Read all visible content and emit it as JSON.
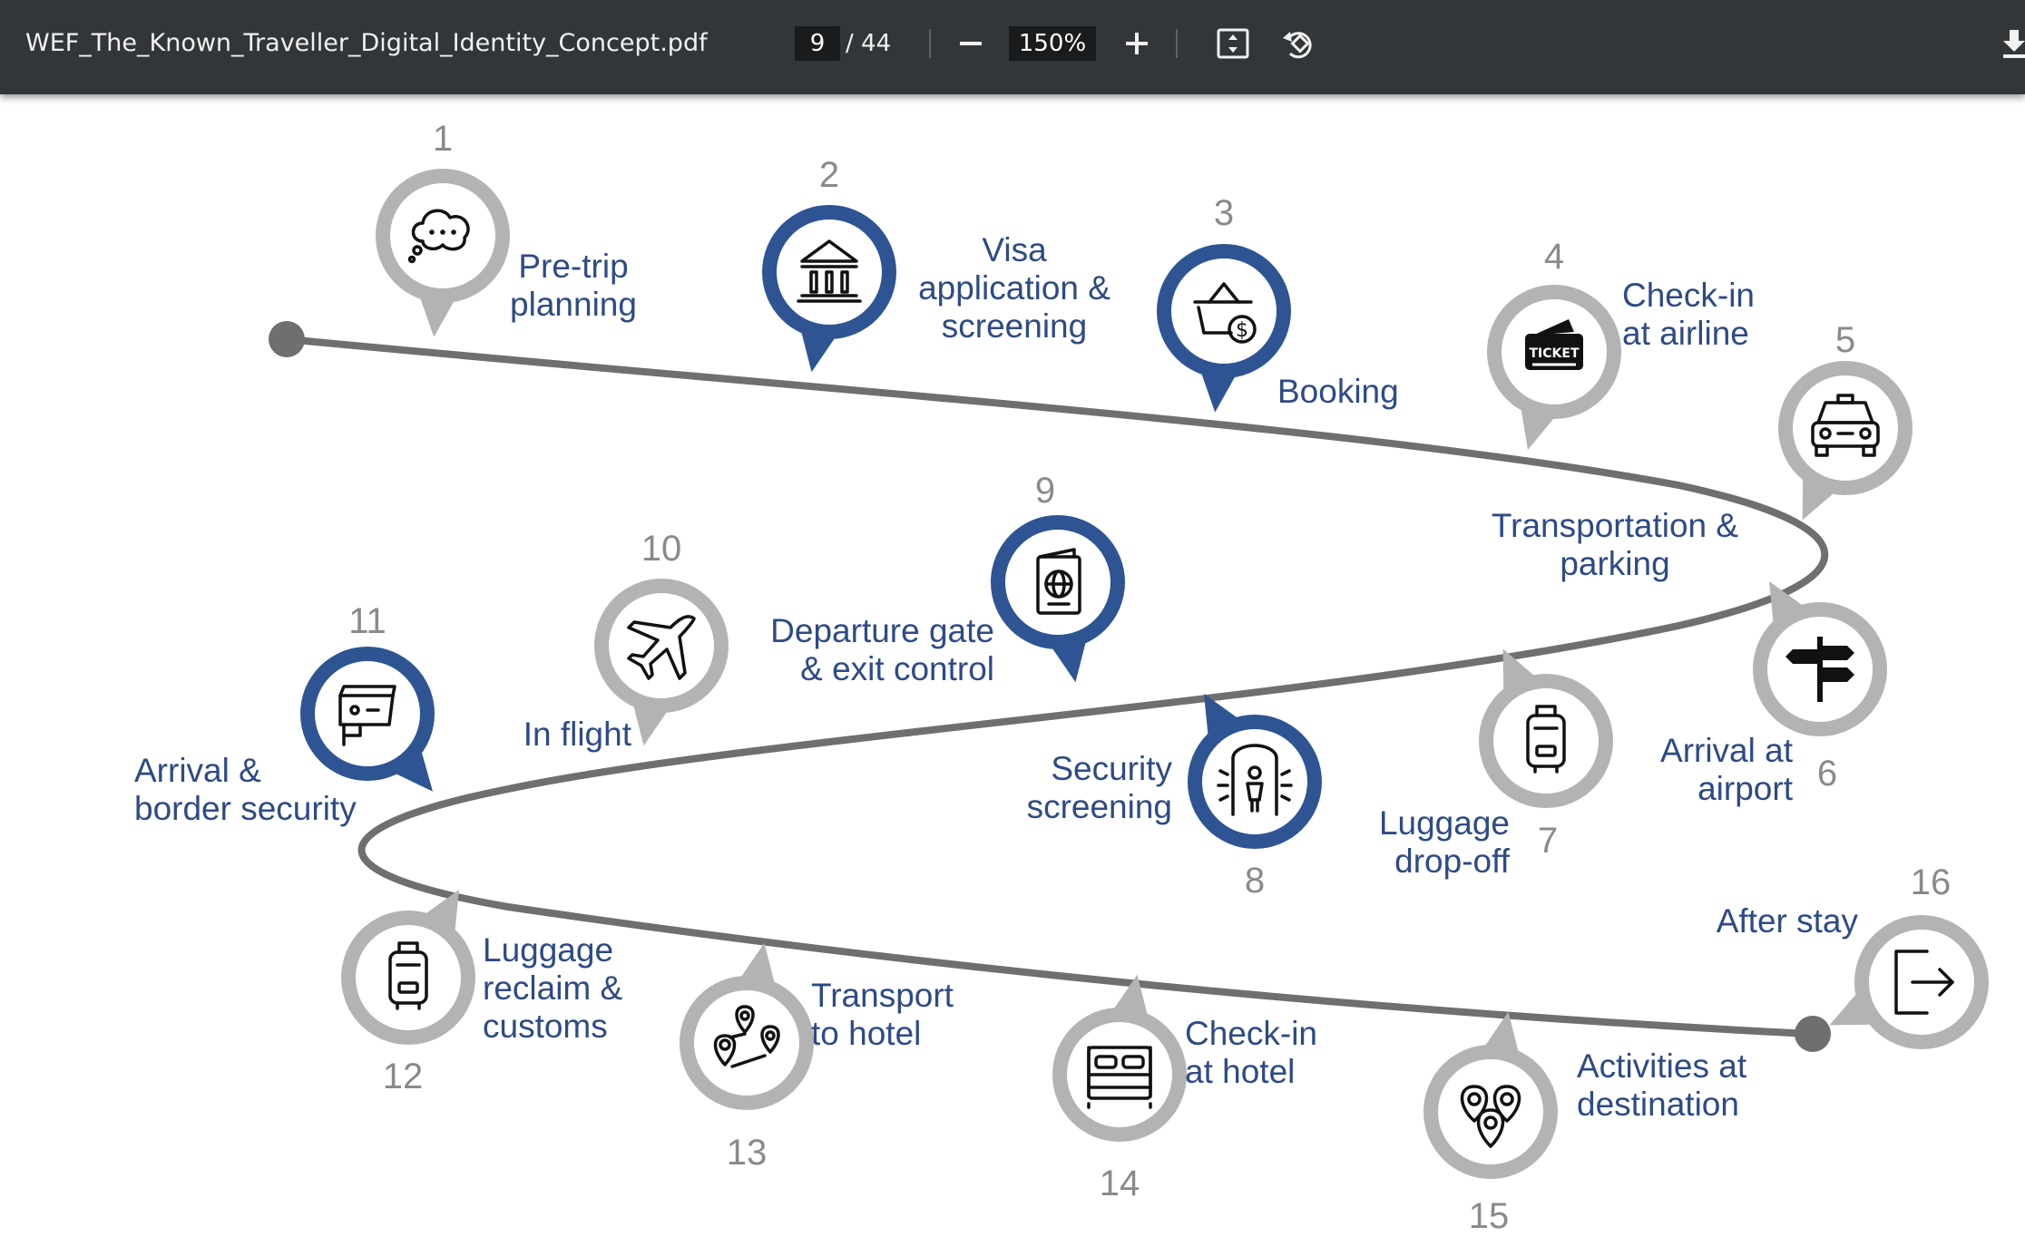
{
  "toolbar": {
    "title": "WEF_The_Known_Traveller_Digital_Identity_Concept.pdf",
    "page_current": "9",
    "page_total": "/ 44",
    "zoom": "150%",
    "icons": [
      "minus-icon",
      "plus-icon",
      "fit-page-icon",
      "rotate-icon",
      "download-icon"
    ]
  },
  "colors": {
    "toolbar_bg": "#323639",
    "blue": "#2e5493",
    "gray": "#b3b3b3",
    "path": "#6f6f6f",
    "label_text": "#2e4a86",
    "number_text": "#8a8a8a"
  },
  "steps": [
    {
      "number": "1",
      "label": [
        "Pre-trip",
        "planning"
      ],
      "style": "gray",
      "icon": "thought-bubble-icon"
    },
    {
      "number": "2",
      "label": [
        "Visa",
        "application &",
        "screening"
      ],
      "style": "blue",
      "icon": "government-building-icon"
    },
    {
      "number": "3",
      "label": [
        "Booking"
      ],
      "style": "blue",
      "icon": "shopping-basket-dollar-icon"
    },
    {
      "number": "4",
      "label": [
        "Check-in",
        "at airline"
      ],
      "style": "gray",
      "icon": "ticket-icon"
    },
    {
      "number": "5",
      "label": [
        "Transportation &",
        "parking"
      ],
      "style": "gray",
      "icon": "taxi-icon"
    },
    {
      "number": "6",
      "label": [
        "Arrival at",
        "airport"
      ],
      "style": "gray",
      "icon": "signpost-icon"
    },
    {
      "number": "7",
      "label": [
        "Luggage",
        "drop-off"
      ],
      "style": "gray",
      "icon": "luggage-icon"
    },
    {
      "number": "8",
      "label": [
        "Security",
        "screening"
      ],
      "style": "blue",
      "icon": "body-scanner-icon"
    },
    {
      "number": "9",
      "label": [
        "Departure gate",
        "& exit control"
      ],
      "style": "blue",
      "icon": "passport-icon"
    },
    {
      "number": "10",
      "label": [
        "In flight"
      ],
      "style": "gray",
      "icon": "airplane-icon"
    },
    {
      "number": "11",
      "label": [
        "Arrival  &",
        "border security"
      ],
      "style": "blue",
      "icon": "security-camera-icon"
    },
    {
      "number": "12",
      "label": [
        "Luggage",
        "reclaim &",
        "customs"
      ],
      "style": "gray",
      "icon": "luggage-icon"
    },
    {
      "number": "13",
      "label": [
        "Transport",
        "to hotel"
      ],
      "style": "gray",
      "icon": "route-pins-icon"
    },
    {
      "number": "14",
      "label": [
        "Check-in",
        "at hotel"
      ],
      "style": "gray",
      "icon": "bed-icon"
    },
    {
      "number": "15",
      "label": [
        "Activities at",
        "destination"
      ],
      "style": "gray",
      "icon": "location-pins-icon"
    },
    {
      "number": "16",
      "label": [
        "After stay"
      ],
      "style": "gray",
      "icon": "exit-icon"
    }
  ]
}
